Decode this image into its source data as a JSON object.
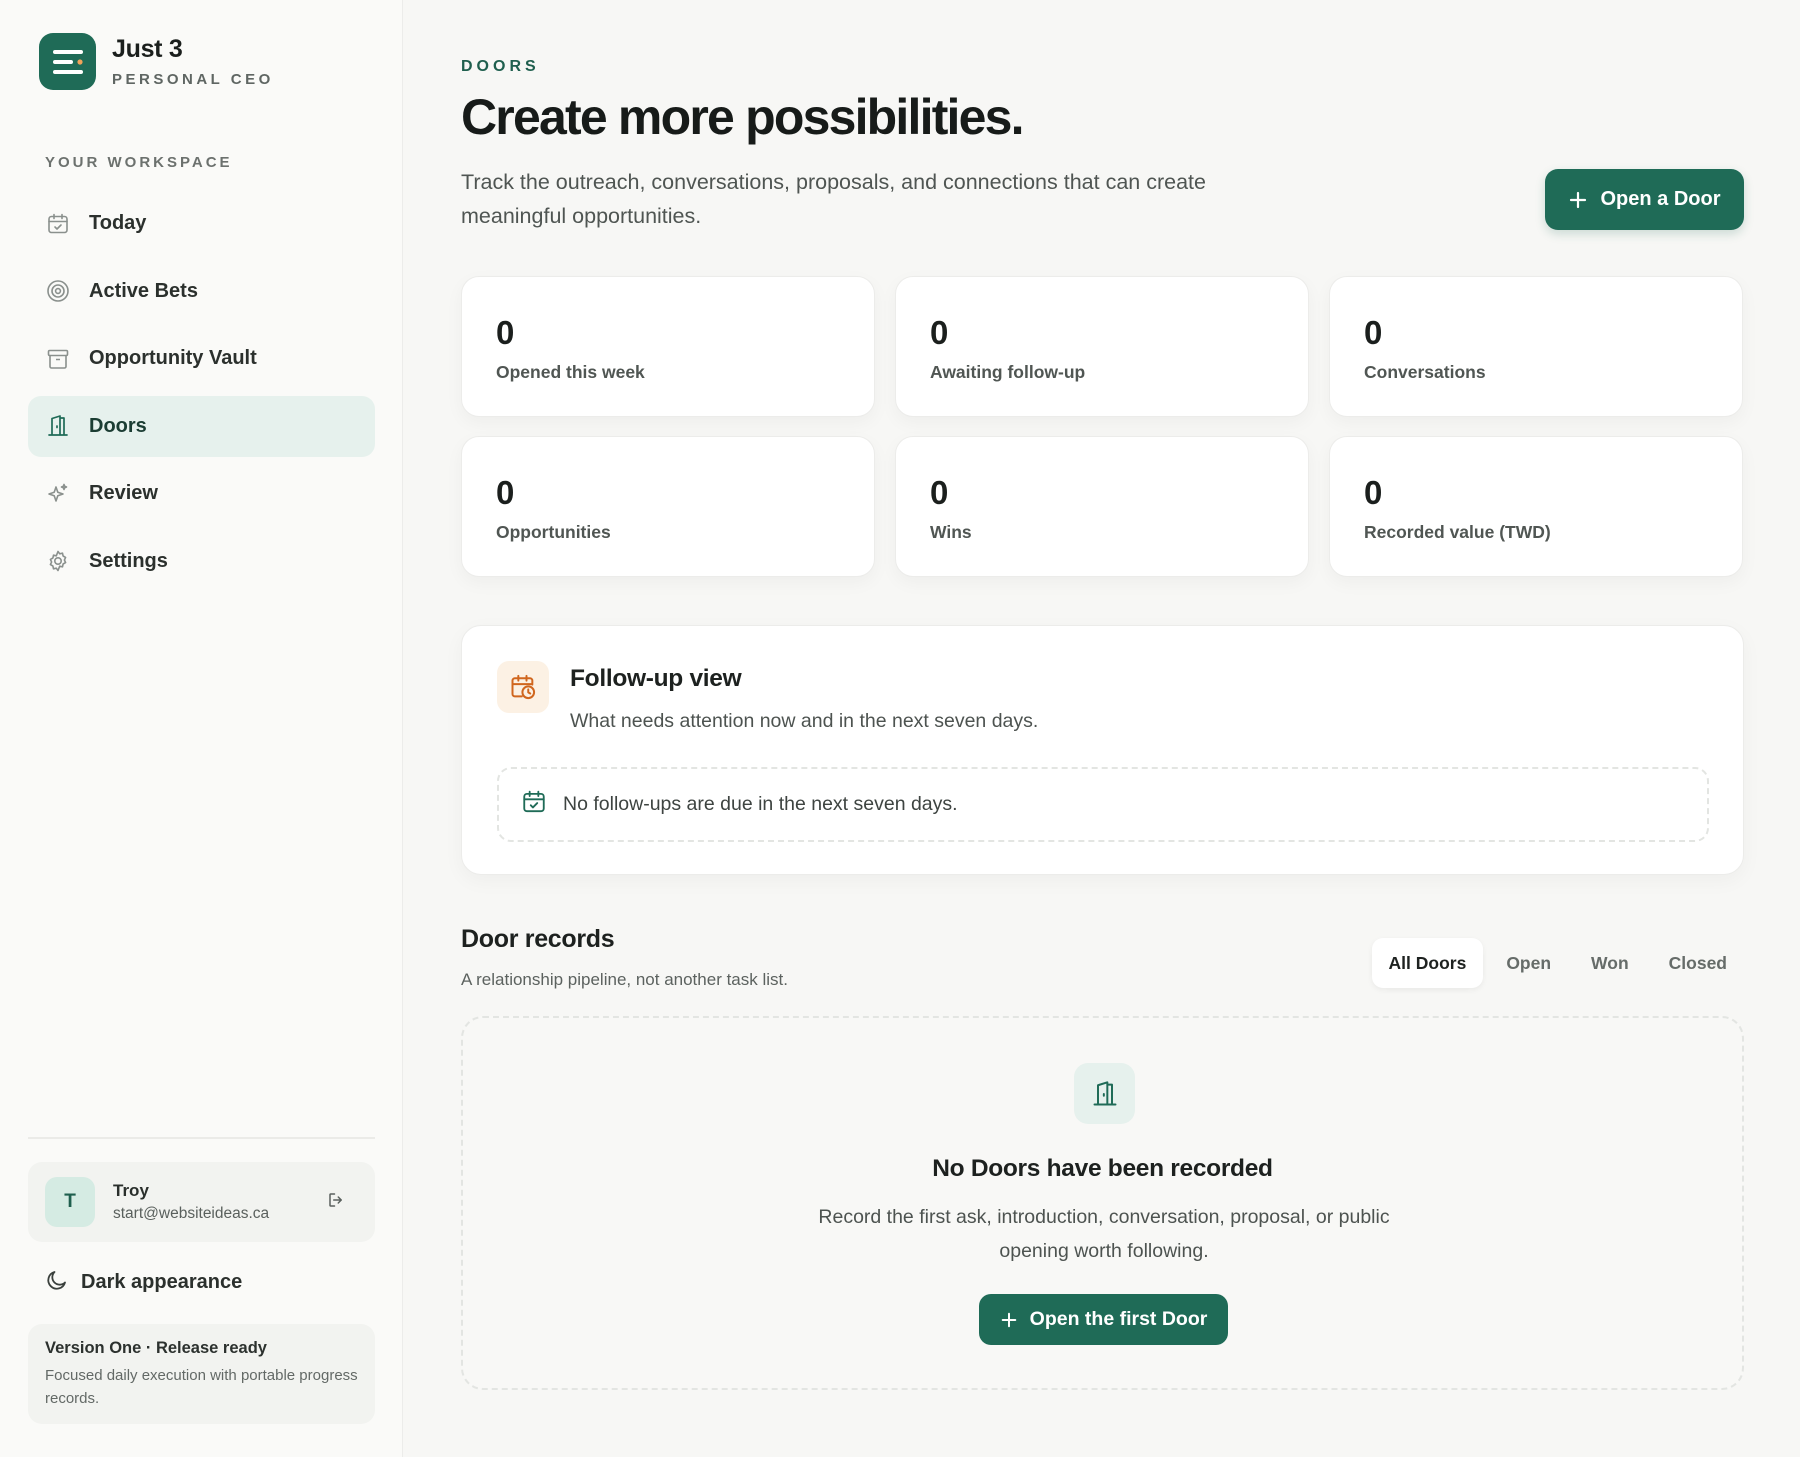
{
  "brand": {
    "name": "Just 3",
    "subtitle": "PERSONAL CEO"
  },
  "sidebar": {
    "section_label": "YOUR WORKSPACE",
    "items": [
      {
        "label": "Today",
        "icon": "calendar-check-icon"
      },
      {
        "label": "Active Bets",
        "icon": "target-icon"
      },
      {
        "label": "Opportunity Vault",
        "icon": "archive-icon"
      },
      {
        "label": "Doors",
        "icon": "door-icon",
        "active": true
      },
      {
        "label": "Review",
        "icon": "sparkle-icon"
      },
      {
        "label": "Settings",
        "icon": "gear-icon"
      }
    ],
    "user": {
      "initial": "T",
      "name": "Troy",
      "email": "start@websiteideas.ca"
    },
    "dark_appearance_label": "Dark appearance",
    "version": {
      "title": "Version One · Release ready",
      "description": "Focused daily execution with portable progress records."
    }
  },
  "header": {
    "eyebrow": "DOORS",
    "title": "Create more possibilities.",
    "description": "Track the outreach, conversations, proposals, and connections that can create meaningful opportunities.",
    "primary_button": "Open a Door"
  },
  "stats": [
    {
      "value": "0",
      "label": "Opened this week"
    },
    {
      "value": "0",
      "label": "Awaiting follow-up"
    },
    {
      "value": "0",
      "label": "Conversations"
    },
    {
      "value": "0",
      "label": "Opportunities"
    },
    {
      "value": "0",
      "label": "Wins"
    },
    {
      "value": "0",
      "label": "Recorded value (TWD)"
    }
  ],
  "followup": {
    "title": "Follow-up view",
    "description": "What needs attention now and in the next seven days.",
    "empty_text": "No follow-ups are due in the next seven days."
  },
  "records": {
    "title": "Door records",
    "subtitle": "A relationship pipeline, not another task list.",
    "filters": [
      "All Doors",
      "Open",
      "Won",
      "Closed"
    ],
    "active_filter": "All Doors",
    "empty_title": "No Doors have been recorded",
    "empty_description": "Record the first ask, introduction, conversation, proposal, or public opening worth following.",
    "empty_button": "Open the first Door"
  },
  "colors": {
    "accent": "#1f6b57",
    "accent_light": "#e6f1ed",
    "warm_icon": "#d0661e",
    "background": "#f7f7f5"
  }
}
